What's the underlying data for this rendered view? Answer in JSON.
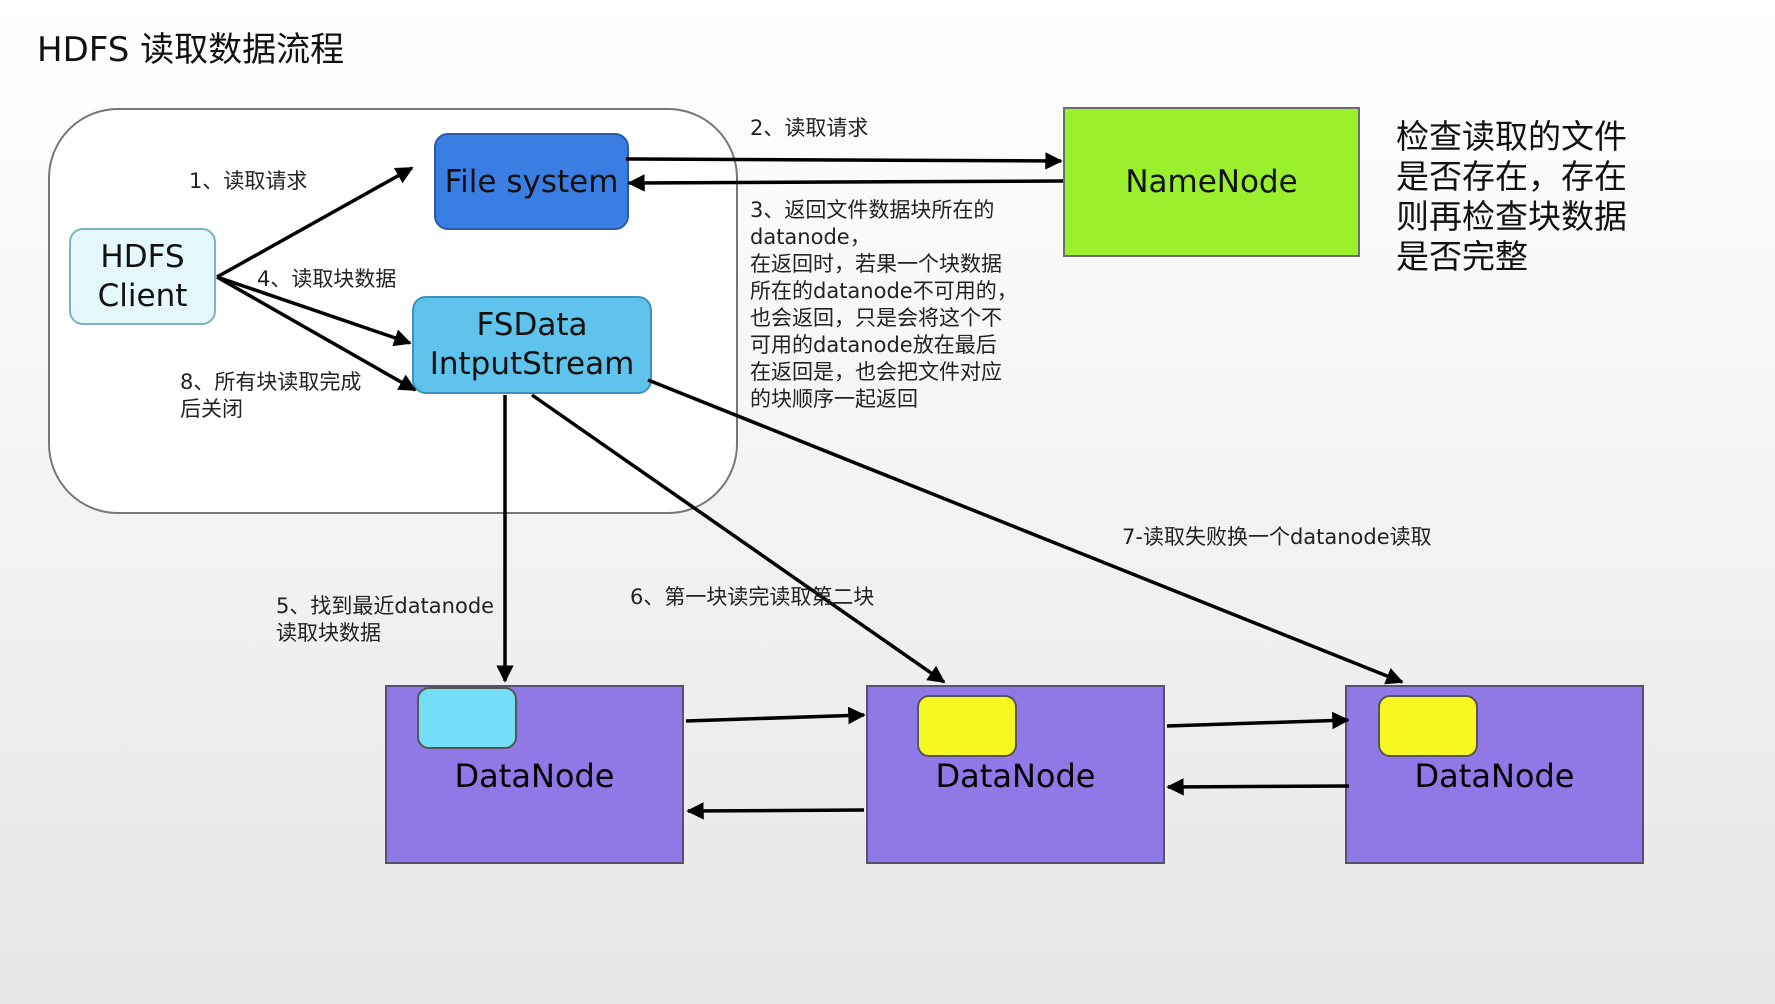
{
  "title": "HDFS  读取数据流程",
  "nodes": {
    "client": [
      "HDFS",
      "Client"
    ],
    "filesystem": "File system",
    "fsdata": [
      "FSData",
      "IntputStream"
    ],
    "namenode": "NameNode",
    "datanodes": [
      "DataNode",
      "DataNode",
      "DataNode"
    ]
  },
  "labels": {
    "step1": "1、读取请求",
    "step2": "2、读取请求",
    "step3": [
      "3、返回文件数据块所在的",
      "datanode，",
      "在返回时，若果一个块数据",
      "所在的datanode不可用的，",
      "也会返回，只是会将这个不",
      "可用的datanode放在最后",
      "在返回是，也会把文件对应",
      "的块顺序一起返回"
    ],
    "step4": "4、读取块数据",
    "step5": [
      "5、找到最近datanode",
      "读取块数据"
    ],
    "step6": "6、第一块读完读取第二块",
    "step7": "7-读取失败换一个datanode读取",
    "step8": [
      "8、所有块读取完成",
      "后关闭"
    ]
  },
  "note": [
    "检查读取的文件",
    "是否存在，存在",
    "则再检查块数据",
    "是否完整"
  ],
  "colors": {
    "filesystem": "#3b7ee3",
    "fsdata": "#5fc3ec",
    "namenode": "#9af02c",
    "datanode": "#9079e6",
    "block_current": "#73def8",
    "block_other": "#f7f722"
  }
}
